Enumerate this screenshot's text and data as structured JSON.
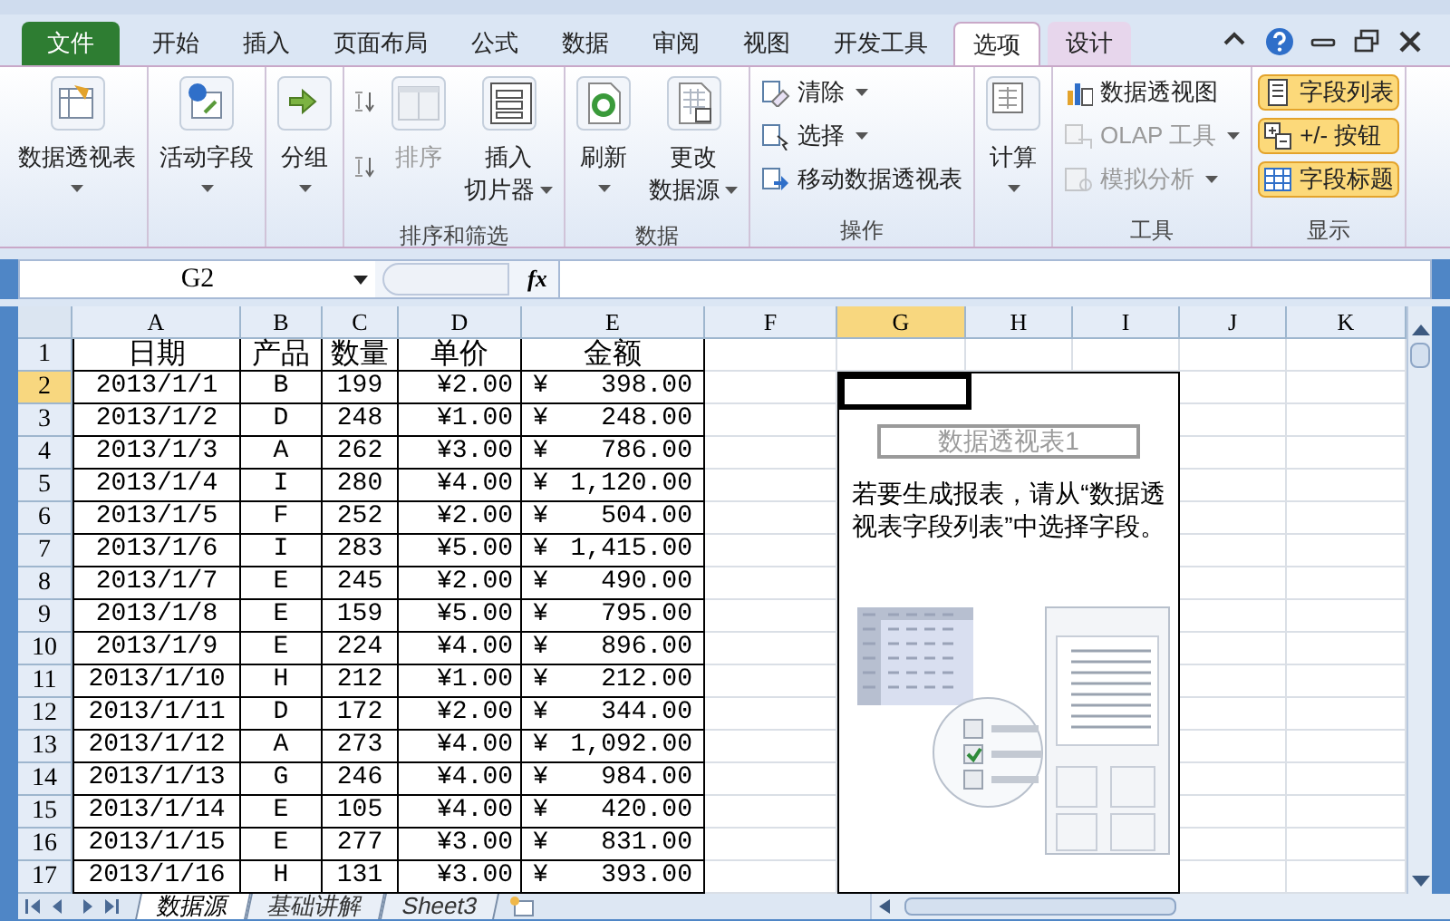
{
  "tabs": [
    {
      "label": "文件",
      "kind": "file",
      "selected": false
    },
    {
      "label": "开始",
      "kind": "tab",
      "selected": false
    },
    {
      "label": "插入",
      "kind": "tab",
      "selected": false
    },
    {
      "label": "页面布局",
      "kind": "tab",
      "selected": false
    },
    {
      "label": "公式",
      "kind": "tab",
      "selected": false
    },
    {
      "label": "数据",
      "kind": "tab",
      "selected": false
    },
    {
      "label": "审阅",
      "kind": "tab",
      "selected": false
    },
    {
      "label": "视图",
      "kind": "tab",
      "selected": false
    },
    {
      "label": "开发工具",
      "kind": "tab",
      "selected": false
    },
    {
      "label": "选项",
      "kind": "context",
      "selected": true
    },
    {
      "label": "设计",
      "kind": "context",
      "selected": false
    }
  ],
  "ribbon": {
    "groups": [
      {
        "items": [
          {
            "kind": "large",
            "lines": [
              "数据透视表"
            ],
            "dropdown": true,
            "disabled": false,
            "on": false
          }
        ]
      },
      {
        "items": [
          {
            "kind": "large",
            "lines": [
              "活动字段"
            ],
            "dropdown": true,
            "disabled": false,
            "on": false
          }
        ]
      },
      {
        "items": [
          {
            "kind": "large",
            "lines": [
              "分组"
            ],
            "dropdown": true,
            "disabled": false,
            "on": false
          }
        ]
      },
      {
        "label": "排序和筛选",
        "items": [
          {
            "kind": "icon"
          },
          {
            "kind": "icon"
          },
          {
            "kind": "large",
            "lines": [
              "排序"
            ],
            "dropdown": false,
            "disabled": true,
            "on": false
          },
          {
            "kind": "large",
            "lines": [
              "插入",
              "切片器"
            ],
            "dropdown": true,
            "disabled": false,
            "on": false
          }
        ]
      },
      {
        "label": "数据",
        "items": [
          {
            "kind": "large",
            "lines": [
              "刷新"
            ],
            "dropdown": true,
            "disabled": false,
            "on": false
          },
          {
            "kind": "large",
            "lines": [
              "更改",
              "数据源"
            ],
            "dropdown": true,
            "disabled": false,
            "on": false
          }
        ]
      },
      {
        "label": "操作",
        "items": [
          {
            "kind": "small",
            "lines": [
              "清除"
            ],
            "dropdown": true,
            "disabled": false,
            "on": false
          },
          {
            "kind": "small",
            "lines": [
              "选择"
            ],
            "dropdown": true,
            "disabled": false,
            "on": false
          },
          {
            "kind": "small",
            "lines": [
              "移动数据透视表"
            ],
            "dropdown": false,
            "disabled": false,
            "on": false
          }
        ]
      },
      {
        "items": [
          {
            "kind": "large",
            "lines": [
              "计算"
            ],
            "dropdown": true,
            "disabled": false,
            "on": false
          }
        ]
      },
      {
        "label": "工具",
        "items": [
          {
            "kind": "small",
            "lines": [
              "数据透视图"
            ],
            "dropdown": false,
            "disabled": false,
            "on": false
          },
          {
            "kind": "small",
            "lines": [
              "OLAP 工具"
            ],
            "dropdown": true,
            "disabled": true,
            "on": false
          },
          {
            "kind": "small",
            "lines": [
              "模拟分析"
            ],
            "dropdown": true,
            "disabled": true,
            "on": false
          }
        ]
      },
      {
        "label": "显示",
        "items": [
          {
            "kind": "small",
            "lines": [
              "字段列表"
            ],
            "dropdown": false,
            "disabled": false,
            "on": true
          },
          {
            "kind": "small",
            "lines": [
              "+/- 按钮"
            ],
            "dropdown": false,
            "disabled": false,
            "on": true
          },
          {
            "kind": "small",
            "lines": [
              "字段标题"
            ],
            "dropdown": false,
            "disabled": false,
            "on": true
          }
        ]
      }
    ]
  },
  "formula_bar": {
    "name_box": "G2",
    "function_button": "fx"
  },
  "sheet": {
    "columns": [
      {
        "label": "A",
        "selected": false
      },
      {
        "label": "B",
        "selected": false
      },
      {
        "label": "C",
        "selected": false
      },
      {
        "label": "D",
        "selected": false
      },
      {
        "label": "E",
        "selected": false
      },
      {
        "label": "F",
        "selected": false
      },
      {
        "label": "G",
        "selected": true
      },
      {
        "label": "H",
        "selected": false
      },
      {
        "label": "I",
        "selected": false
      },
      {
        "label": "J",
        "selected": false
      },
      {
        "label": "K",
        "selected": false
      }
    ],
    "header_row": {
      "number": "1",
      "selected": false,
      "cells": [
        "日期",
        "产品",
        "数量",
        "单价",
        "金额"
      ]
    },
    "rows": [
      {
        "number": "2",
        "selected": true,
        "date": "2013/1/1",
        "product": "B",
        "quantity": "199",
        "unit_price": "¥2.00",
        "currency": "¥",
        "amount": "398.00"
      },
      {
        "number": "3",
        "selected": false,
        "date": "2013/1/2",
        "product": "D",
        "quantity": "248",
        "unit_price": "¥1.00",
        "currency": "¥",
        "amount": "248.00"
      },
      {
        "number": "4",
        "selected": false,
        "date": "2013/1/3",
        "product": "A",
        "quantity": "262",
        "unit_price": "¥3.00",
        "currency": "¥",
        "amount": "786.00"
      },
      {
        "number": "5",
        "selected": false,
        "date": "2013/1/4",
        "product": "I",
        "quantity": "280",
        "unit_price": "¥4.00",
        "currency": "¥",
        "amount": "1,120.00"
      },
      {
        "number": "6",
        "selected": false,
        "date": "2013/1/5",
        "product": "F",
        "quantity": "252",
        "unit_price": "¥2.00",
        "currency": "¥",
        "amount": "504.00"
      },
      {
        "number": "7",
        "selected": false,
        "date": "2013/1/6",
        "product": "I",
        "quantity": "283",
        "unit_price": "¥5.00",
        "currency": "¥",
        "amount": "1,415.00"
      },
      {
        "number": "8",
        "selected": false,
        "date": "2013/1/7",
        "product": "E",
        "quantity": "245",
        "unit_price": "¥2.00",
        "currency": "¥",
        "amount": "490.00"
      },
      {
        "number": "9",
        "selected": false,
        "date": "2013/1/8",
        "product": "E",
        "quantity": "159",
        "unit_price": "¥5.00",
        "currency": "¥",
        "amount": "795.00"
      },
      {
        "number": "10",
        "selected": false,
        "date": "2013/1/9",
        "product": "E",
        "quantity": "224",
        "unit_price": "¥4.00",
        "currency": "¥",
        "amount": "896.00"
      },
      {
        "number": "11",
        "selected": false,
        "date": "2013/1/10",
        "product": "H",
        "quantity": "212",
        "unit_price": "¥1.00",
        "currency": "¥",
        "amount": "212.00"
      },
      {
        "number": "12",
        "selected": false,
        "date": "2013/1/11",
        "product": "D",
        "quantity": "172",
        "unit_price": "¥2.00",
        "currency": "¥",
        "amount": "344.00"
      },
      {
        "number": "13",
        "selected": false,
        "date": "2013/1/12",
        "product": "A",
        "quantity": "273",
        "unit_price": "¥4.00",
        "currency": "¥",
        "amount": "1,092.00"
      },
      {
        "number": "14",
        "selected": false,
        "date": "2013/1/13",
        "product": "G",
        "quantity": "246",
        "unit_price": "¥4.00",
        "currency": "¥",
        "amount": "984.00"
      },
      {
        "number": "15",
        "selected": false,
        "date": "2013/1/14",
        "product": "E",
        "quantity": "105",
        "unit_price": "¥4.00",
        "currency": "¥",
        "amount": "420.00"
      },
      {
        "number": "16",
        "selected": false,
        "date": "2013/1/15",
        "product": "E",
        "quantity": "277",
        "unit_price": "¥3.00",
        "currency": "¥",
        "amount": "831.00"
      },
      {
        "number": "17",
        "selected": false,
        "date": "2013/1/16",
        "product": "H",
        "quantity": "131",
        "unit_price": "¥3.00",
        "currency": "¥",
        "amount": "393.00"
      }
    ],
    "pivot_placeholder": {
      "title": "数据透视表1",
      "message": "若要生成报表，请从“数据透视表字段列表”中选择字段。"
    }
  },
  "sheet_tabs": [
    {
      "label": "数据源",
      "selected": true
    },
    {
      "label": "基础讲解",
      "selected": false
    },
    {
      "label": "Sheet3",
      "selected": false
    }
  ]
}
